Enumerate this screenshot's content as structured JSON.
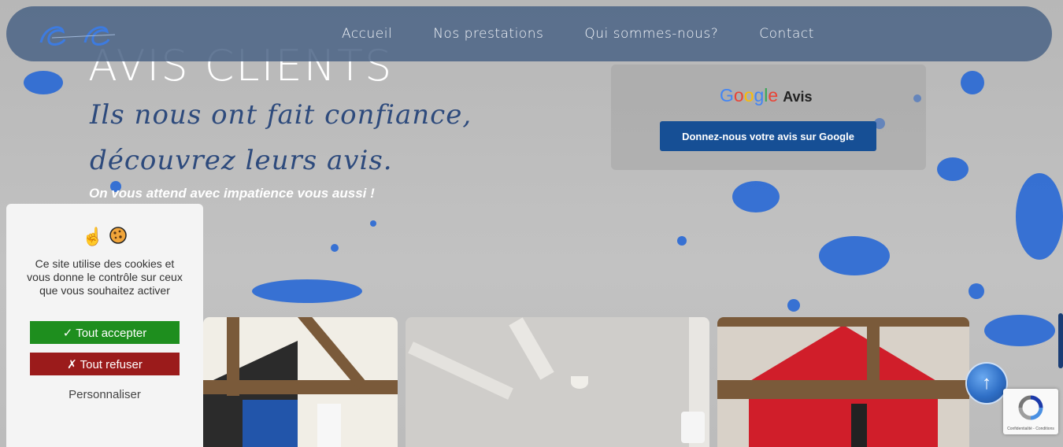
{
  "nav": {
    "items": [
      {
        "label": "Accueil"
      },
      {
        "label": "Nos prestations"
      },
      {
        "label": "Qui sommes-nous?"
      },
      {
        "label": "Contact"
      }
    ]
  },
  "hero": {
    "title": "AVIS CLIENTS",
    "script_line1": "Ils nous ont fait confiance,",
    "script_line2": "découvrez leurs avis.",
    "tagline": "On vous attend avec impatience vous aussi !"
  },
  "google_card": {
    "brand": "Google",
    "label": "Avis",
    "button_label": "Donnez-nous votre avis sur Google"
  },
  "cookie_banner": {
    "text": "Ce site utilise des cookies et vous donne le contrôle sur ceux que vous souhaitez activer",
    "accept_label": "✓ Tout accepter",
    "refuse_label": "✗ Tout refuser",
    "customize_label": "Personnaliser"
  },
  "recaptcha": {
    "text": "Confidentialité - Conditions"
  },
  "colors": {
    "nav_bg": "#4a6385",
    "button_blue": "#164f95",
    "accept_green": "#1e8e1e",
    "refuse_red": "#9b1b1b",
    "splat_blue": "#1f63d6"
  },
  "icons": [
    "hand-pointing-icon",
    "cookie-icon",
    "arrow-up-icon",
    "recaptcha-icon"
  ]
}
